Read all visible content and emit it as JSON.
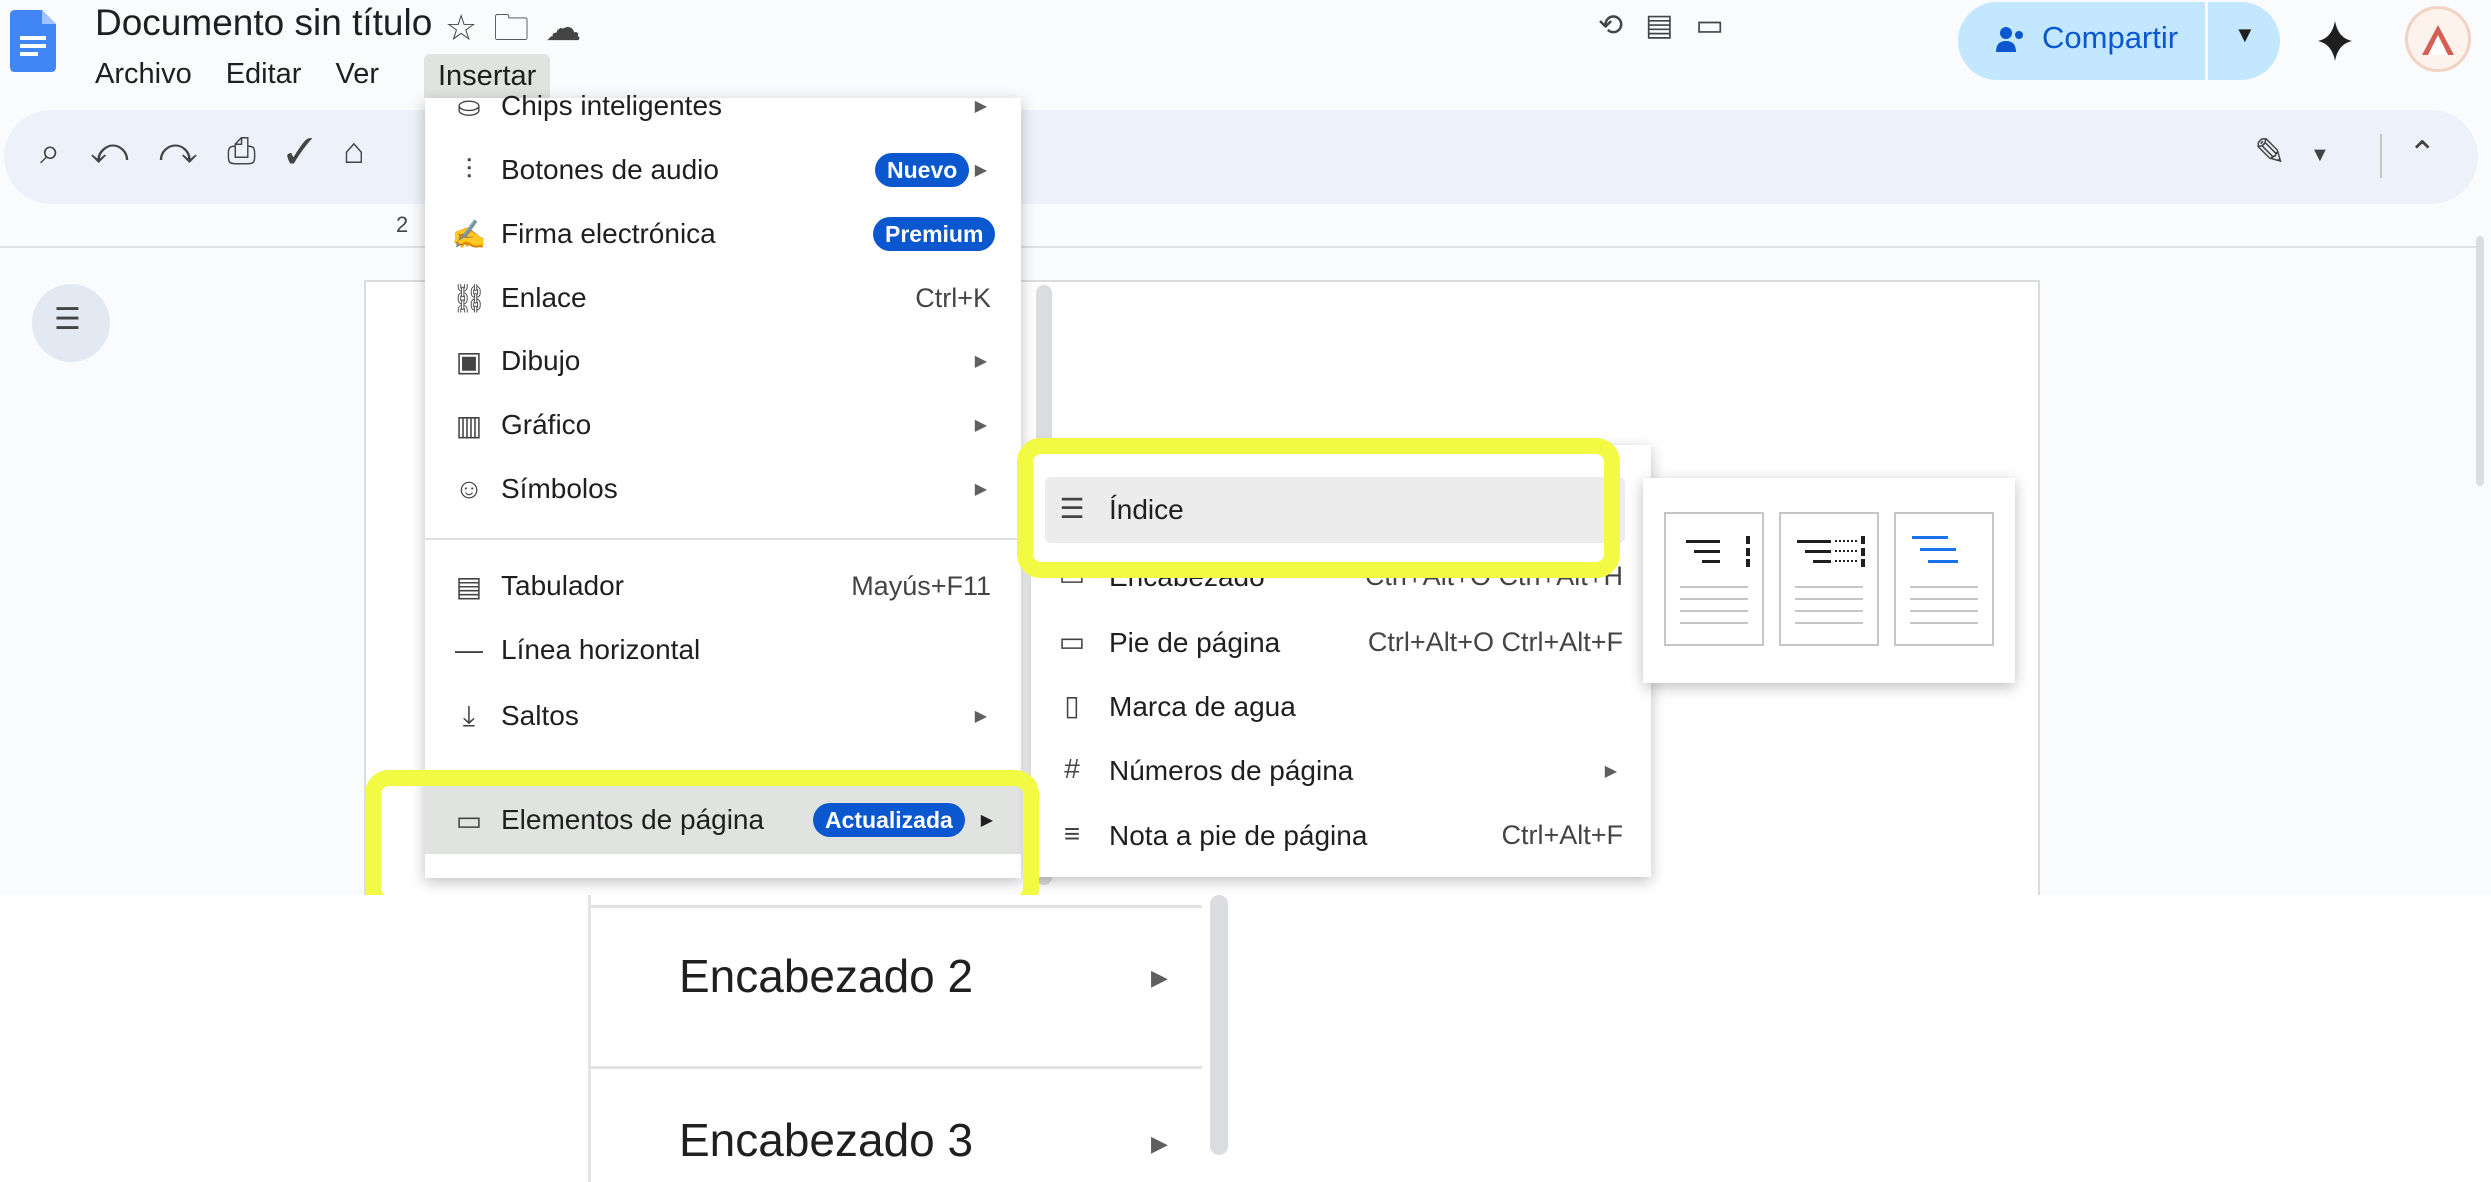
{
  "header": {
    "title": "Documento sin título",
    "menus": [
      "Archivo",
      "Editar",
      "Ver"
    ],
    "active_menu": "Insertar",
    "share_label": "Compartir"
  },
  "toolbar": {
    "ruler_number": "2"
  },
  "insert_menu": {
    "partial_top_item": "Chips inteligentes",
    "items": [
      {
        "label": "Botones de audio",
        "badge": "Nuevo"
      },
      {
        "label": "Firma electrónica",
        "badge": "Premium"
      },
      {
        "label": "Enlace",
        "shortcut": "Ctrl+K"
      },
      {
        "label": "Dibujo"
      },
      {
        "label": "Gráfico"
      },
      {
        "label": "Símbolos"
      },
      {
        "label": "Tabulador",
        "shortcut": "Mayús+F11"
      },
      {
        "label": "Línea horizontal"
      },
      {
        "label": "Saltos"
      },
      {
        "label": "Elementos de página",
        "badge": "Actualizada"
      }
    ]
  },
  "page_elements_menu": {
    "items": [
      {
        "label": "Índice"
      },
      {
        "label": "Encabezado",
        "shortcut": "Ctrl+Alt+O Ctrl+Alt+H"
      },
      {
        "label": "Pie de página",
        "shortcut": "Ctrl+Alt+O Ctrl+Alt+F"
      },
      {
        "label": "Marca de agua"
      },
      {
        "label": "Números de página"
      },
      {
        "label": "Nota a pie de página",
        "shortcut": "Ctrl+Alt+F"
      }
    ]
  },
  "toc_options": [
    "numbered-toc",
    "dotted-numbered-toc",
    "linked-toc"
  ],
  "lower_section": {
    "items": [
      "Encabezado 2",
      "Encabezado 3"
    ]
  },
  "colors": {
    "highlight": "#f2fa44",
    "accent": "#0b57d0",
    "share_bg": "#c2e7ff"
  }
}
